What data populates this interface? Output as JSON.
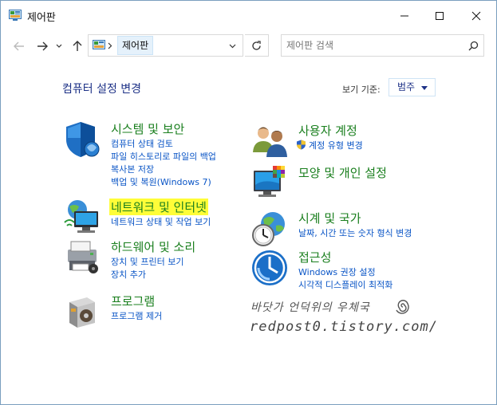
{
  "window": {
    "title": "제어판"
  },
  "navbar": {
    "breadcrumb": "제어판",
    "search_placeholder": "제어판 검색"
  },
  "header": {
    "page_title": "컴퓨터 설정 변경",
    "viewby_label": "보기 기준:",
    "viewby_value": "범주"
  },
  "categories": [
    {
      "title": "시스템 및 보안",
      "links": [
        "컴퓨터 상태 검토",
        "파일 히스토리로 파일의 백업",
        "복사본 저장",
        "백업 및 복원(Windows 7)"
      ]
    },
    {
      "title": "네트워크 및 인터넷",
      "highlighted": true,
      "links": [
        "네트워크 상태 및 작업 보기"
      ]
    },
    {
      "title": "하드웨어 및 소리",
      "links": [
        "장치 및 프린터 보기",
        "장치 추가"
      ]
    },
    {
      "title": "프로그램",
      "links": [
        "프로그램 제거"
      ]
    },
    {
      "title": "사용자 계정",
      "links": [
        "계정 유형 변경"
      ]
    },
    {
      "title": "모양 및 개인 설정",
      "links": []
    },
    {
      "title": "시계 및 국가",
      "links": [
        "날짜, 시간 또는 숫자 형식 변경"
      ]
    },
    {
      "title": "접근성",
      "links": [
        "Windows 권장 설정",
        "시각적 디스플레이 최적화"
      ]
    }
  ],
  "watermark": {
    "line1": "바닷가 언덕위의 우체국",
    "line2": "redpost0.tistory.com/"
  },
  "colors": {
    "accent_link": "#0a55c6",
    "category_title": "#1a7f1e",
    "page_title": "#1e3287",
    "highlight": "#fffd38"
  }
}
